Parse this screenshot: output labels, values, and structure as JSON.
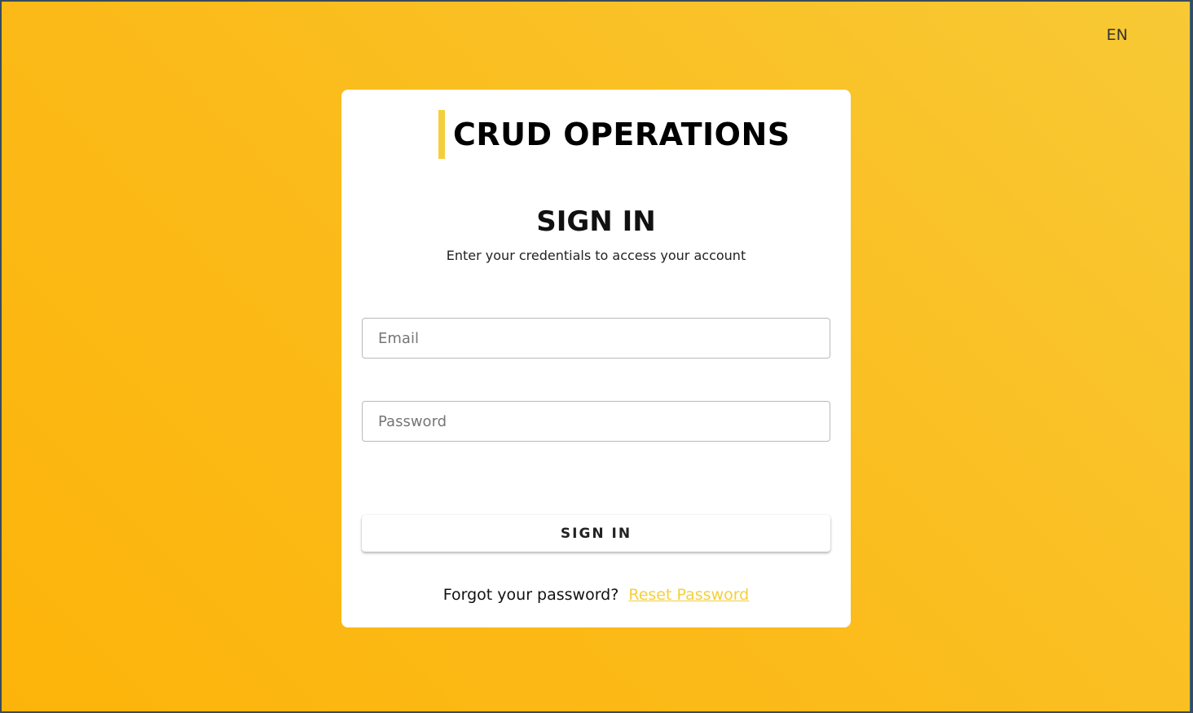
{
  "language": {
    "selector_label": "EN"
  },
  "brand": {
    "title": "CRUD OPERATIONS",
    "accent_color": "#f5cf3b"
  },
  "signin": {
    "heading": "SIGN IN",
    "subheading": "Enter your credentials to access your account",
    "email_placeholder": "Email",
    "email_value": "",
    "password_placeholder": "Password",
    "password_value": "",
    "submit_label": "SIGN IN",
    "forgot_text": "Forgot your password?",
    "reset_link_label": "Reset Password"
  },
  "colors": {
    "background_gradient": [
      "#f8c935",
      "#fdb40a"
    ],
    "card_background": "#ffffff",
    "link_color": "#f5cf3b"
  }
}
